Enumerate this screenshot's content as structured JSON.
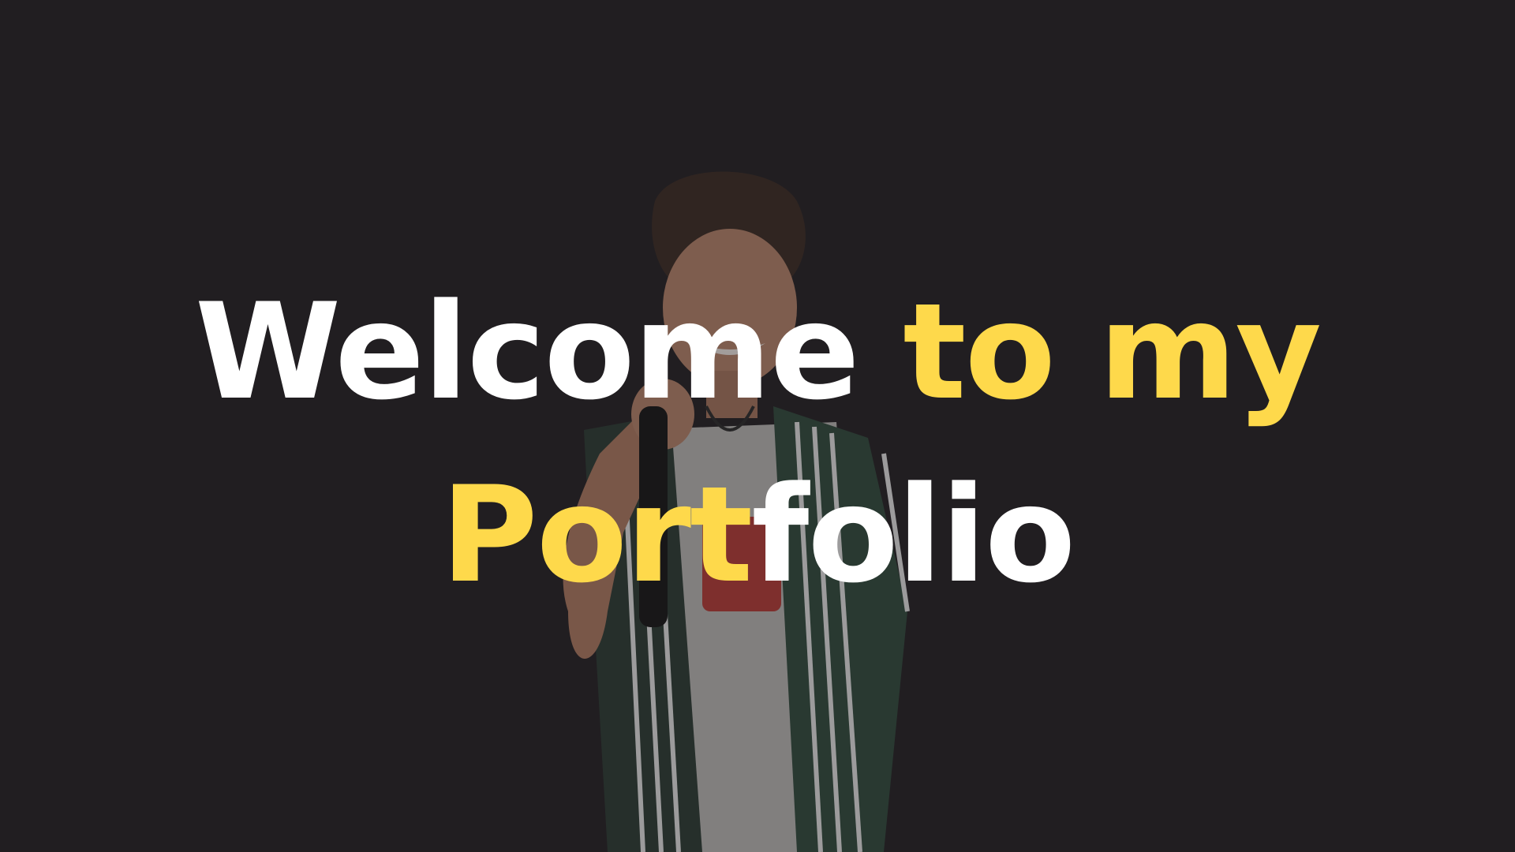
{
  "colors": {
    "background": "#211e21",
    "text_primary": "#ffffff",
    "text_accent": "#fed94b"
  },
  "hero": {
    "line1_white": "Welcome",
    "line1_accent": "to my",
    "line2_accent": "Port",
    "line2_white": "folio",
    "portrait_icon": "person-photo"
  }
}
